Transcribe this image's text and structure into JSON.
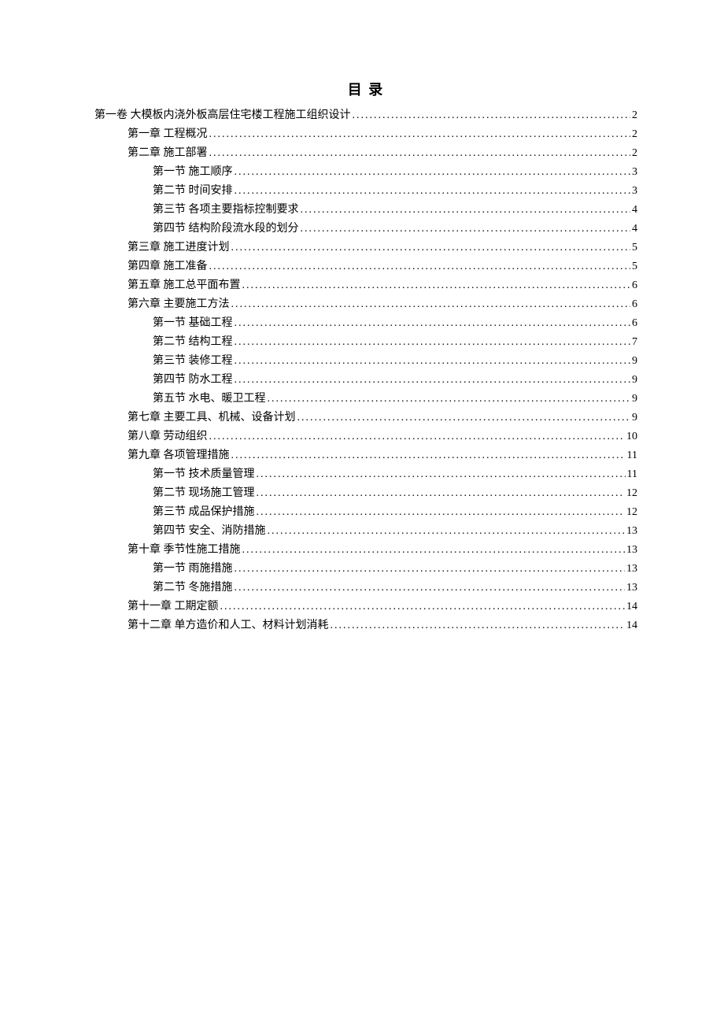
{
  "title": "目 录",
  "toc": [
    {
      "indent": 0,
      "label": "第一卷  大模板内浇外板高层住宅楼工程施工组织设计",
      "page": "2"
    },
    {
      "indent": 1,
      "label": "第一章  工程概况",
      "page": "2"
    },
    {
      "indent": 1,
      "label": "第二章  施工部署",
      "page": "2"
    },
    {
      "indent": 2,
      "label": "第一节  施工顺序",
      "page": "3"
    },
    {
      "indent": 2,
      "label": "第二节  时间安排",
      "page": "3"
    },
    {
      "indent": 2,
      "label": "第三节  各项主要指标控制要求",
      "page": "4"
    },
    {
      "indent": 2,
      "label": "第四节  结构阶段流水段的划分",
      "page": "4"
    },
    {
      "indent": 1,
      "label": "第三章  施工进度计划",
      "page": "5"
    },
    {
      "indent": 1,
      "label": "第四章  施工准备",
      "page": "5"
    },
    {
      "indent": 1,
      "label": "第五章  施工总平面布置",
      "page": "6"
    },
    {
      "indent": 1,
      "label": "第六章  主要施工方法",
      "page": "6"
    },
    {
      "indent": 2,
      "label": "第一节  基础工程",
      "page": "6"
    },
    {
      "indent": 2,
      "label": "第二节  结构工程",
      "page": "7"
    },
    {
      "indent": 2,
      "label": "第三节  装修工程",
      "page": "9"
    },
    {
      "indent": 2,
      "label": "第四节  防水工程",
      "page": "9"
    },
    {
      "indent": 2,
      "label": "第五节  水电、暖卫工程",
      "page": "9"
    },
    {
      "indent": 1,
      "label": "第七章  主要工具、机械、设备计划",
      "page": "9"
    },
    {
      "indent": 1,
      "label": "第八章  劳动组织",
      "page": "10"
    },
    {
      "indent": 1,
      "label": "第九章  各项管理措施",
      "page": "11"
    },
    {
      "indent": 2,
      "label": "第一节  技术质量管理",
      "page": "11"
    },
    {
      "indent": 2,
      "label": "第二节  现场施工管理",
      "page": "12"
    },
    {
      "indent": 2,
      "label": "第三节  成品保护措施",
      "page": "12"
    },
    {
      "indent": 2,
      "label": "第四节  安全、消防措施",
      "page": "13"
    },
    {
      "indent": 1,
      "label": "第十章  季节性施工措施",
      "page": "13"
    },
    {
      "indent": 2,
      "label": "第一节  雨施措施",
      "page": "13"
    },
    {
      "indent": 2,
      "label": "第二节  冬施措施",
      "page": "13"
    },
    {
      "indent": 1,
      "label": "第十一章  工期定额",
      "page": "14"
    },
    {
      "indent": 1,
      "label": "第十二章  单方造价和人工、材料计划消耗",
      "page": "14"
    }
  ]
}
